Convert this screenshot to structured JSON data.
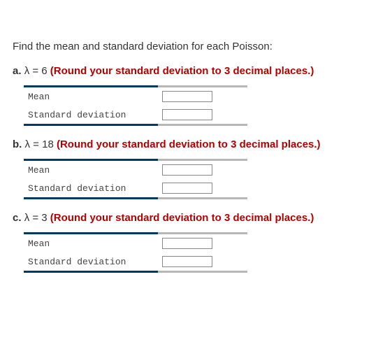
{
  "prompt": "Find the mean and standard deviation for each Poisson:",
  "parts": {
    "a": {
      "label": "a.",
      "eq": "λ = 6",
      "instr": "(Round your standard deviation to 3 decimal places.)",
      "rows": {
        "mean": "Mean",
        "sd": "Standard deviation"
      }
    },
    "b": {
      "label": "b.",
      "eq": "λ = 18",
      "instr": "(Round your standard deviation to 3 decimal places.)",
      "rows": {
        "mean": "Mean",
        "sd": "Standard deviation"
      }
    },
    "c": {
      "label": "c.",
      "eq": "λ = 3",
      "instr": "(Round your standard deviation to 3 decimal places.)",
      "rows": {
        "mean": "Mean",
        "sd": "Standard deviation"
      }
    }
  }
}
